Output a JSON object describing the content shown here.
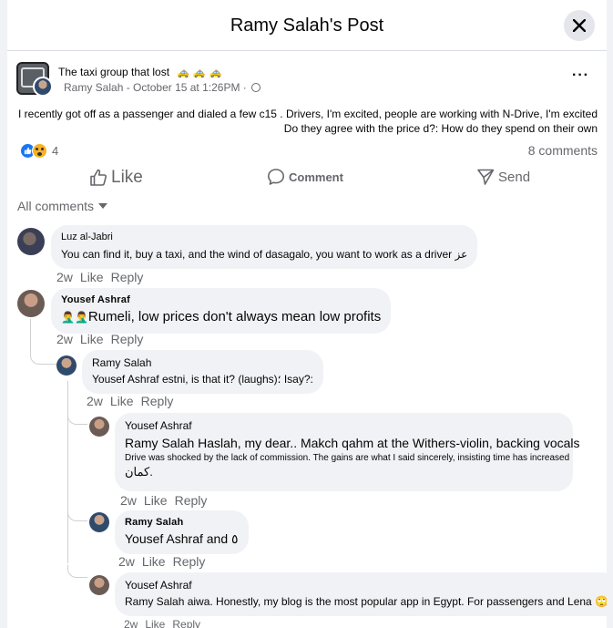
{
  "modal": {
    "title": "Ramy Salah's Post"
  },
  "post": {
    "group": "The taxi group that lost",
    "group_emoji": "🚕🚕🚕",
    "author": "Ramy Salah",
    "date": "October 15 at 1:26PM",
    "text_line1": "I recently got off as a passenger and dialed a few c15 . Drivers, I'm excited, people are working with N-Drive, I'm excited",
    "text_line2": "Do they agree with the price d?: How do they spend on their own",
    "reaction_count": "4",
    "comments_count": "8 comments"
  },
  "actions": {
    "like": "Like",
    "comment": "Comment",
    "send": "Send"
  },
  "filter": {
    "label": "All comments"
  },
  "comments": [
    {
      "author": "Luz al-Jabri",
      "text": "You can find it, buy a taxi, and the wind of dasagalo, you want to work as a driver عز",
      "time": "2w",
      "like": "Like",
      "reply": "Reply"
    },
    {
      "author": "Yousef Ashraf",
      "emoji": "🤦‍♂️🤦‍♂️",
      "text": "Rumeli, low prices don't always mean low profits",
      "time": "2w",
      "like": "Like",
      "reply": "Reply"
    },
    {
      "author": "Ramy Salah",
      "text": "Yousef Ashraf estni, is that it? (laughs)؛ Isay?:",
      "time": "2w",
      "like": "Like",
      "reply": "Reply"
    },
    {
      "author": "Yousef Ashraf",
      "text": "Ramy Salah Haslah, my dear.. Makch qahm at the Withers-violin, backing vocals",
      "text2": "Drive was shocked by the lack of commission. The gains are what I said sincerely, insisting time has increased",
      "text3": "كمان.",
      "time": "2w",
      "like": "Like",
      "reply": "Reply"
    },
    {
      "author": "Ramy Salah",
      "text": "Yousef Ashraf and ٥",
      "time": "2w",
      "like": "Like",
      "reply": "Reply"
    },
    {
      "author": "Yousef Ashraf",
      "text": "Ramy Salah aiwa. Honestly, my blog is the most popular app in Egypt. For passengers and Lena 🙄",
      "time": "2w",
      "like": "Like",
      "reply": "Reply"
    }
  ]
}
